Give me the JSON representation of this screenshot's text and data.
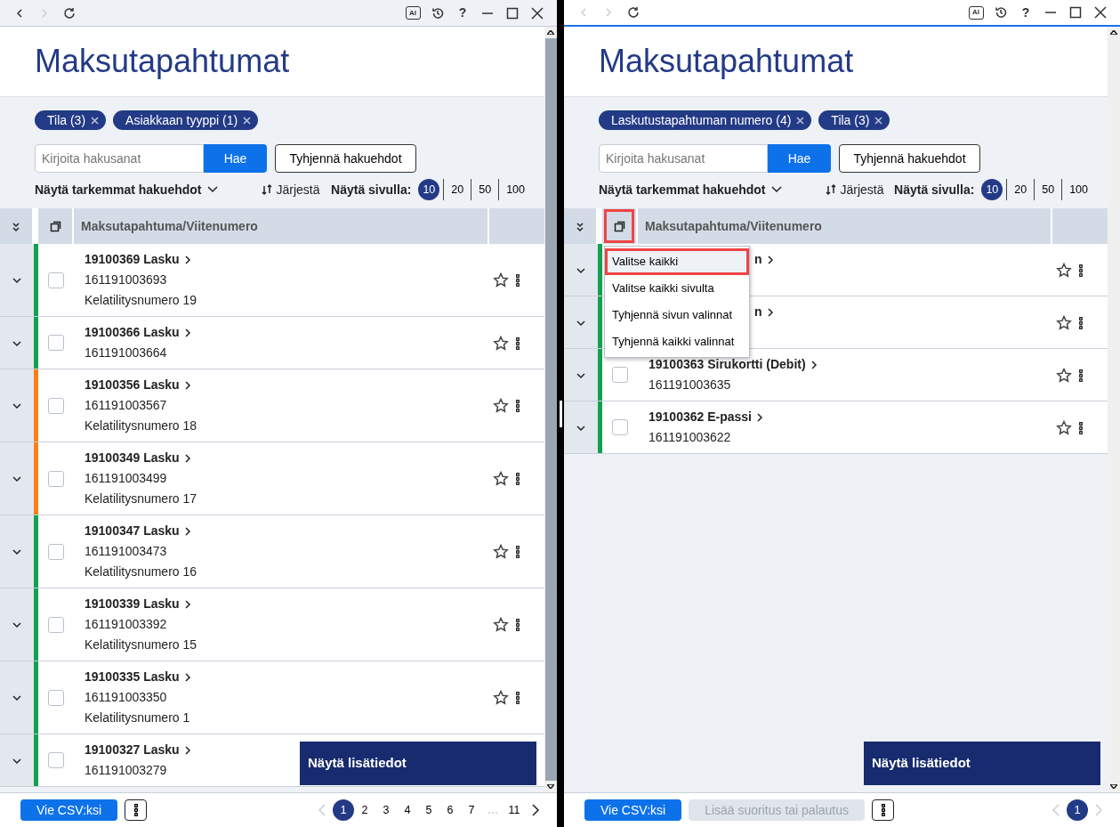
{
  "panes": [
    {
      "focused": false,
      "back_enabled": true,
      "forward_enabled": false,
      "ai_badge": "AI",
      "help": "?",
      "scroll_thumb": true,
      "title": "Maksutapahtumat",
      "chips": [
        {
          "label": "Tila (3)"
        },
        {
          "label": "Asiakkaan tyyppi (1)"
        }
      ],
      "search": {
        "placeholder": "Kirjoita hakusanat",
        "button": "Hae"
      },
      "clear_button": "Tyhjennä hakuehdot",
      "advanced_toggle": "Näytä tarkemmat hakuehdot",
      "sort": "Järjestä",
      "page_size_label": "Näytä sivulla:",
      "page_sizes": [
        {
          "label": "10",
          "selected": true
        },
        {
          "label": "20",
          "selected": false
        },
        {
          "label": "50",
          "selected": false
        },
        {
          "label": "100",
          "selected": false
        }
      ],
      "column_header": "Maksutapahtuma/Viitenumero",
      "select_annotated": false,
      "rows": [
        {
          "color": "#12a150",
          "covered": false,
          "title": "19100369 Lasku",
          "reference": "161191003693",
          "kela": "Kelatilitysnumero 19",
          "checked": false,
          "starred": false
        },
        {
          "color": "#12a150",
          "covered": false,
          "title": "19100366 Lasku",
          "reference": "161191003664",
          "checked": false,
          "starred": false
        },
        {
          "color": "#fd7e14",
          "covered": false,
          "title": "19100356 Lasku",
          "reference": "161191003567",
          "kela": "Kelatilitysnumero 18",
          "checked": false,
          "starred": false
        },
        {
          "color": "#fd7e14",
          "covered": false,
          "title": "19100349 Lasku",
          "reference": "161191003499",
          "kela": "Kelatilitysnumero 17",
          "checked": false,
          "starred": false
        },
        {
          "color": "#12a150",
          "covered": false,
          "title": "19100347 Lasku",
          "reference": "161191003473",
          "kela": "Kelatilitysnumero 16",
          "checked": false,
          "starred": false
        },
        {
          "color": "#12a150",
          "covered": false,
          "title": "19100339 Lasku",
          "reference": "161191003392",
          "kela": "Kelatilitysnumero 15",
          "checked": false,
          "starred": false
        },
        {
          "color": "#12a150",
          "covered": false,
          "title": "19100335 Lasku",
          "reference": "161191003350",
          "kela": "Kelatilitysnumero 1",
          "checked": false,
          "starred": false
        },
        {
          "color": "#12a150",
          "covered": false,
          "title": "19100327 Lasku",
          "reference": "161191003279",
          "checked": false
        }
      ],
      "details_button": "Näytä lisätiedot",
      "footer_buttons": [
        {
          "label": "Vie CSV:ksi",
          "disabled": false
        }
      ],
      "prev_enabled": false,
      "next_enabled": true,
      "pages": [
        {
          "label": "1",
          "selected": true,
          "kind": "page"
        },
        {
          "label": "2",
          "selected": false,
          "kind": "page"
        },
        {
          "label": "3",
          "selected": false,
          "kind": "page"
        },
        {
          "label": "4",
          "selected": false,
          "kind": "page"
        },
        {
          "label": "5",
          "selected": false,
          "kind": "page"
        },
        {
          "label": "6",
          "selected": false,
          "kind": "page"
        },
        {
          "label": "7",
          "selected": false,
          "kind": "page"
        },
        {
          "label": "…",
          "kind": "gap"
        },
        {
          "label": "11",
          "selected": false,
          "kind": "page"
        }
      ]
    },
    {
      "focused": true,
      "back_enabled": false,
      "forward_enabled": false,
      "ai_badge": "AI",
      "help": "?",
      "scroll_thumb": false,
      "title": "Maksutapahtumat",
      "chips": [
        {
          "label": "Laskutustapahtuman numero (4)"
        },
        {
          "label": "Tila (3)"
        }
      ],
      "search": {
        "placeholder": "Kirjoita hakusanat",
        "button": "Hae"
      },
      "clear_button": "Tyhjennä hakuehdot",
      "advanced_toggle": "Näytä tarkemmat hakuehdot",
      "sort": "Järjestä",
      "page_size_label": "Näytä sivulla:",
      "page_sizes": [
        {
          "label": "10",
          "selected": true
        },
        {
          "label": "20",
          "selected": false
        },
        {
          "label": "50",
          "selected": false
        },
        {
          "label": "100",
          "selected": false
        }
      ],
      "column_header": "Maksutapahtuma/Viitenumero",
      "select_annotated": true,
      "select_menu": [
        {
          "label": "Valitse kaikki",
          "highlighted": true
        },
        {
          "label": "Valitse kaikki sivulta",
          "highlighted": false
        },
        {
          "label": "Tyhjennä sivun valinnat",
          "highlighted": false
        },
        {
          "label": "Tyhjennä kaikki valinnat",
          "highlighted": false
        }
      ],
      "rows": [
        {
          "color": "#12a150",
          "covered": true,
          "title": "n",
          "starred": false
        },
        {
          "color": "#12a150",
          "covered": true,
          "title": "n",
          "starred": false
        },
        {
          "color": "#12a150",
          "covered": false,
          "title": "19100363 Sirukortti (Debit)",
          "reference": "161191003635",
          "checked": false,
          "starred": false
        },
        {
          "color": "#12a150",
          "covered": false,
          "title": "19100362 E-passi",
          "reference": "161191003622",
          "checked": false,
          "starred": false
        }
      ],
      "details_button": "Näytä lisätiedot",
      "footer_buttons": [
        {
          "label": "Vie CSV:ksi",
          "disabled": false
        },
        {
          "label": "Lisää suoritus tai palautus",
          "disabled": true
        }
      ],
      "prev_enabled": false,
      "next_enabled": false,
      "pages": [
        {
          "label": "1",
          "selected": true,
          "kind": "page"
        }
      ]
    }
  ]
}
